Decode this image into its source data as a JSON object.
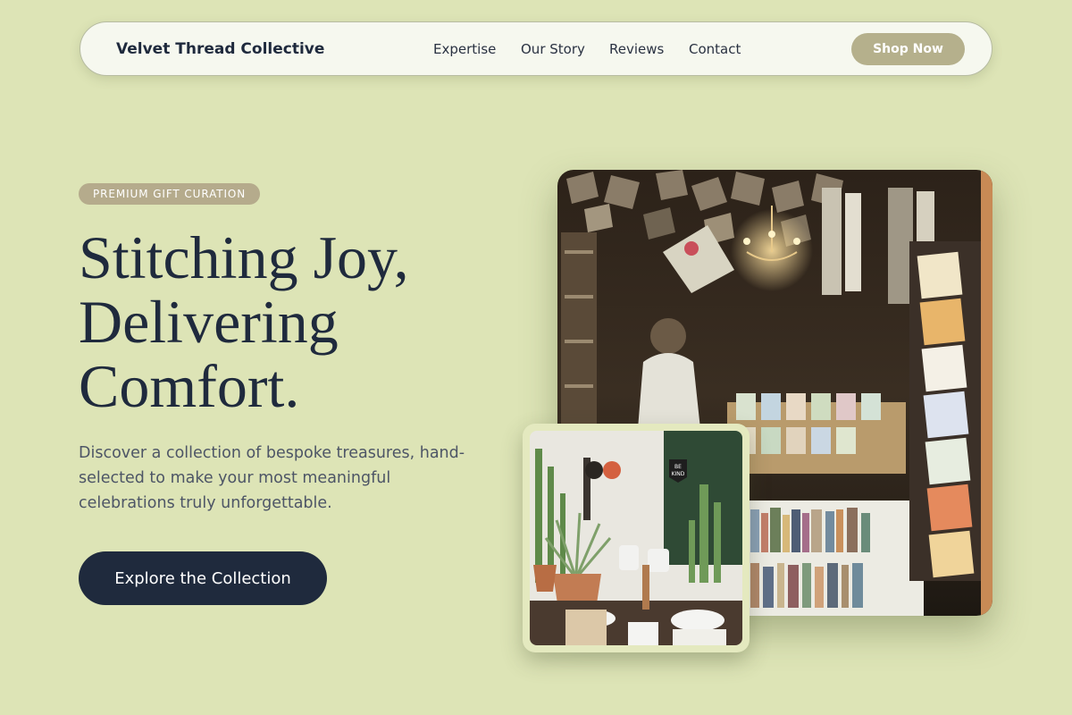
{
  "header": {
    "brand": "Velvet Thread Collective",
    "nav": [
      {
        "label": "Expertise"
      },
      {
        "label": "Our Story"
      },
      {
        "label": "Reviews"
      },
      {
        "label": "Contact"
      }
    ],
    "cta_label": "Shop Now"
  },
  "hero": {
    "badge": "PREMIUM GIFT CURATION",
    "headline": [
      "Stitching Joy,",
      "Delivering",
      "Comfort."
    ],
    "description": "Discover a collection of bespoke treasures, hand-selected to make your most meaningful celebrations truly unforgettable.",
    "cta_label": "Explore the Collection"
  },
  "images": {
    "main": "gift-shop-interior-photo",
    "secondary": "plants-and-pottery-shelf-photo",
    "sign_text": "BE KIND"
  },
  "colors": {
    "background": "#dde4b6",
    "accent": "#b5b08c",
    "primary": "#1f2a3d"
  }
}
